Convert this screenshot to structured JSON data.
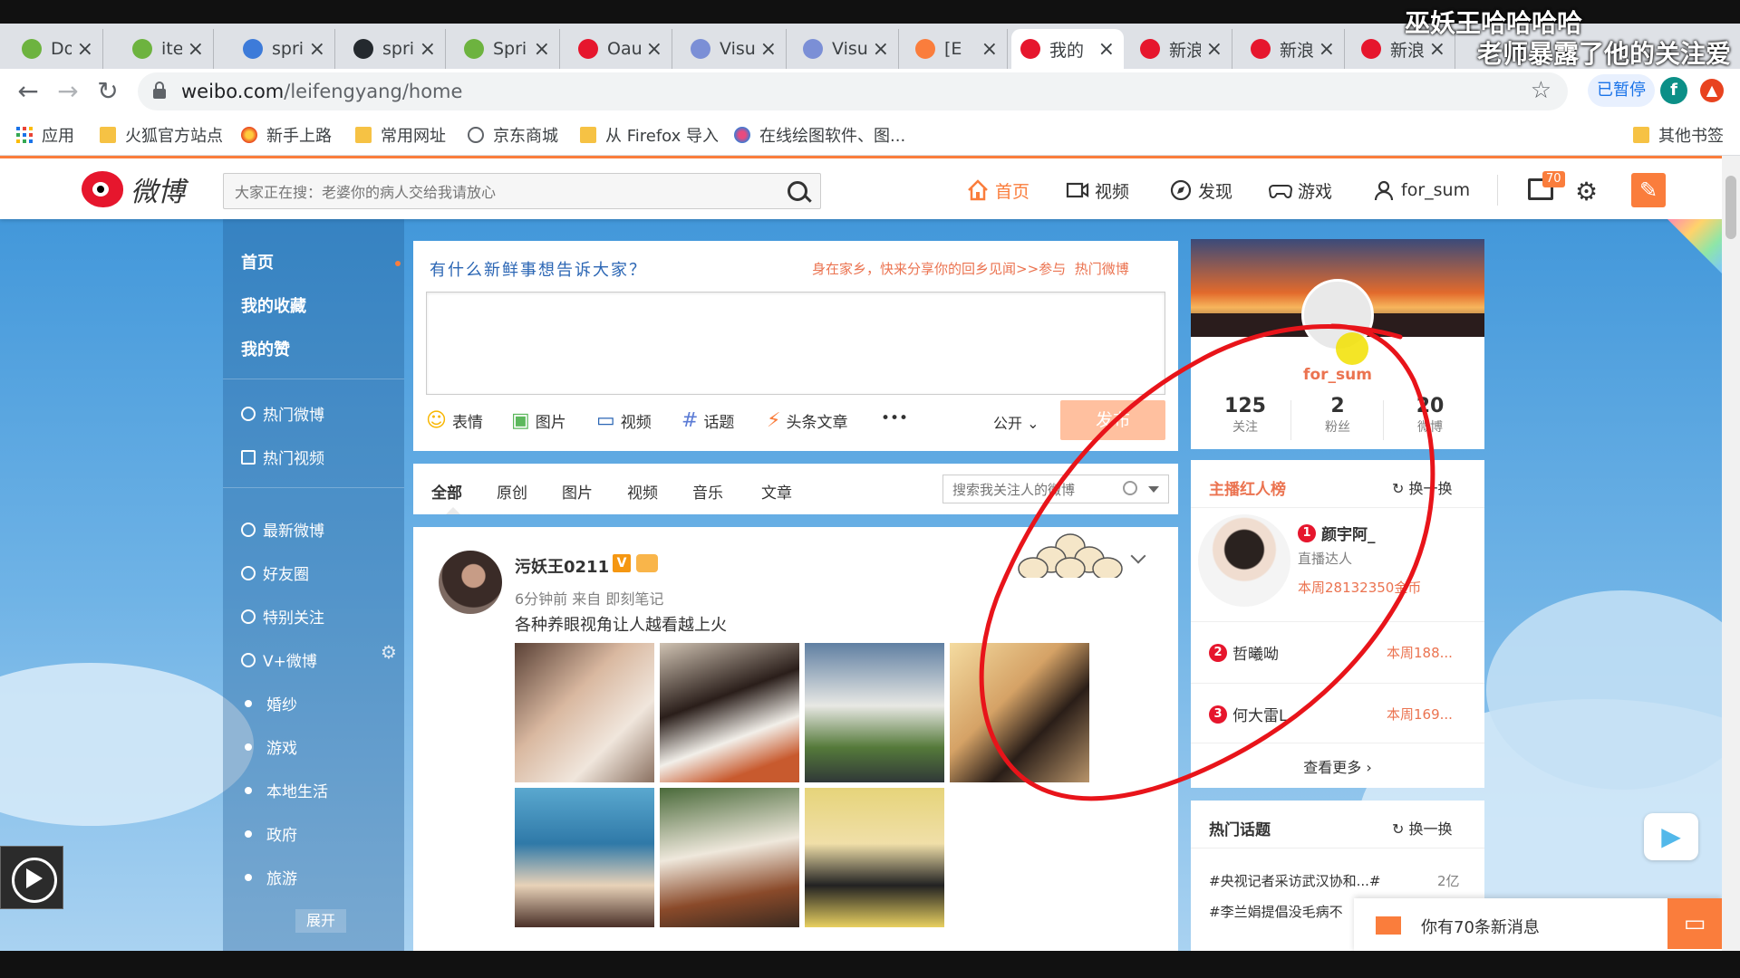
{
  "overlay": {
    "line1": "巫妖王哈哈哈哈",
    "line2": "老师暴露了他的关注爱"
  },
  "browser": {
    "tabs": [
      {
        "title": "Doc",
        "color": "#6db33f"
      },
      {
        "title": "item",
        "color": "#6db33f"
      },
      {
        "title": "spri",
        "color": "#3d7bd9"
      },
      {
        "title": "spri",
        "color": "#24292e"
      },
      {
        "title": "Spri",
        "color": "#6db33f"
      },
      {
        "title": "Oau",
        "color": "#e6162d"
      },
      {
        "title": "Visu",
        "color": "#7b8fd6"
      },
      {
        "title": "Visu",
        "color": "#7b8fd6"
      },
      {
        "title": "[E",
        "color": "#fa7d3c"
      },
      {
        "title": "我的",
        "color": "#e6162d"
      },
      {
        "title": "新浪",
        "color": "#e6162d"
      },
      {
        "title": "新浪",
        "color": "#e6162d"
      },
      {
        "title": "新浪",
        "color": "#e6162d"
      }
    ],
    "close_glyph": "×",
    "url_host": "weibo.com",
    "url_path": "/leifengyang/home",
    "paused_label": "已暂停",
    "profile_initial": "f",
    "bookmarks": [
      {
        "label": "应用",
        "icon": "apps-icon"
      },
      {
        "label": "火狐官方站点",
        "icon": "folder-icon"
      },
      {
        "label": "新手上路",
        "icon": "firefox-icon"
      },
      {
        "label": "常用网址",
        "icon": "folder-icon"
      },
      {
        "label": "京东商城",
        "icon": "globe-icon"
      },
      {
        "label": "从 Firefox 导入",
        "icon": "folder-icon"
      },
      {
        "label": "在线绘图软件、图...",
        "icon": "draw-icon"
      }
    ],
    "other_bookmarks": "其他书签"
  },
  "weibo": {
    "logo_text": "微博",
    "search_placeholder": "大家正在搜：老婆你的病人交给我请放心",
    "nav": {
      "home": "首页",
      "video": "视频",
      "discover": "发现",
      "game": "游戏",
      "user": "for_sum"
    },
    "msg_badge": "70",
    "left_nav": {
      "top": [
        "首页",
        "我的收藏",
        "我的赞"
      ],
      "hot": [
        "热门微博",
        "热门视频"
      ],
      "groups": [
        "最新微博",
        "好友圈",
        "特别关注",
        "V+微博"
      ],
      "tags": [
        "婚纱",
        "游戏",
        "本地生活",
        "政府",
        "旅游"
      ],
      "expand": "展开"
    },
    "composer": {
      "prompt": "有什么新鲜事想告诉大家？",
      "promo": "身在家乡，快来分享你的回乡见闻>>参与",
      "promo_link": "热门微博",
      "tools": [
        "表情",
        "图片",
        "视频",
        "话题",
        "头条文章"
      ],
      "more": "•••",
      "visibility": "公开",
      "submit": "发布"
    },
    "feed_tabs": [
      "全部",
      "原创",
      "图片",
      "视频",
      "音乐",
      "文章"
    ],
    "feed_search_placeholder": "搜索我关注人的微博",
    "post": {
      "user": "污妖王0211",
      "v_badge": "V",
      "meta": "6分钟前 来自 即刻笔记",
      "text": "各种养眼视角让人越看越上火"
    },
    "profile": {
      "name": "for_sum",
      "stats": [
        {
          "num": "125",
          "label": "关注"
        },
        {
          "num": "2",
          "label": "粉丝"
        },
        {
          "num": "20",
          "label": "微博"
        }
      ]
    },
    "anchor_rank": {
      "title": "主播红人榜",
      "refresh": "换一换",
      "first": {
        "rank": "1",
        "name": "颜宇阿_",
        "role": "直播达人",
        "score": "本周28132350金币"
      },
      "others": [
        {
          "rank": "2",
          "name": "哲曦呦",
          "score": "本周188..."
        },
        {
          "rank": "3",
          "name": "何大雷L",
          "score": "本周169..."
        }
      ],
      "more": "查看更多 ›"
    },
    "hot_topics": {
      "title": "热门话题",
      "refresh": "换一换",
      "items": [
        {
          "text": "#央视记者采访武汉协和...#",
          "count": "2亿"
        },
        {
          "text": "#李兰娟提倡没毛病不",
          "count": ""
        }
      ]
    },
    "notice": "你有70条新消息"
  }
}
